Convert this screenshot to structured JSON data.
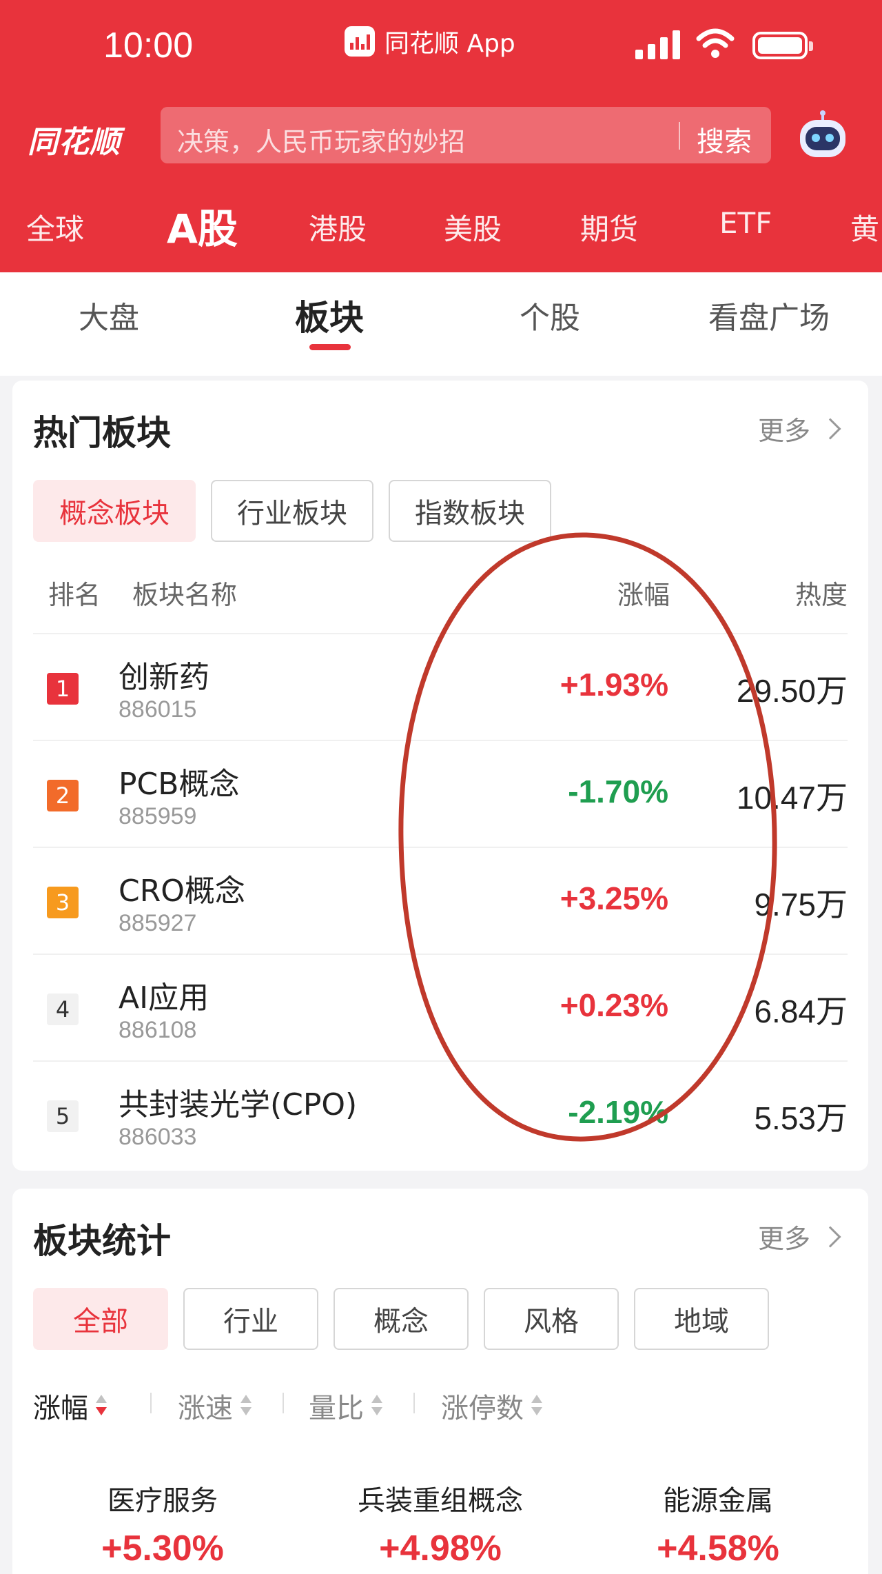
{
  "status": {
    "time": "10:00",
    "app_label": "同花顺 App"
  },
  "header": {
    "logo": "同花顺",
    "search_placeholder": "决策，人民币玩家的妙招",
    "search_button": "搜索"
  },
  "market_tabs": [
    "全球",
    "A股",
    "港股",
    "美股",
    "期货",
    "ETF",
    "黄"
  ],
  "sub_tabs": [
    "大盘",
    "板块",
    "个股",
    "看盘广场"
  ],
  "hot": {
    "title": "热门板块",
    "more": "更多",
    "chips": [
      "概念板块",
      "行业板块",
      "指数板块"
    ],
    "columns": {
      "rank": "排名",
      "name": "板块名称",
      "change": "涨幅",
      "heat": "热度"
    },
    "rows": [
      {
        "rank": "1",
        "name": "创新药",
        "code": "886015",
        "change": "+1.93%",
        "heat": "29.50万"
      },
      {
        "rank": "2",
        "name": "PCB概念",
        "code": "885959",
        "change": "-1.70%",
        "heat": "10.47万"
      },
      {
        "rank": "3",
        "name": "CRO概念",
        "code": "885927",
        "change": "+3.25%",
        "heat": "9.75万"
      },
      {
        "rank": "4",
        "name": "AI应用",
        "code": "886108",
        "change": "+0.23%",
        "heat": "6.84万"
      },
      {
        "rank": "5",
        "name": "共封装光学(CPO)",
        "code": "886033",
        "change": "-2.19%",
        "heat": "5.53万"
      }
    ]
  },
  "stats": {
    "title": "板块统计",
    "more": "更多",
    "chips": [
      "全部",
      "行业",
      "概念",
      "风格",
      "地域"
    ],
    "sorts": [
      "涨幅",
      "涨速",
      "量比",
      "涨停数"
    ],
    "tiles": [
      {
        "name": "医疗服务",
        "change": "+5.30%"
      },
      {
        "name": "兵装重组概念",
        "change": "+4.98%"
      },
      {
        "name": "能源金属",
        "change": "+4.58%"
      }
    ]
  },
  "colors": {
    "brand_red": "#e8333c",
    "up": "#e8333c",
    "down": "#1f9e50",
    "rank1": "#e8333c",
    "rank2": "#f26b2a",
    "rank3": "#f79a1e",
    "annotation": "#c0392b"
  }
}
